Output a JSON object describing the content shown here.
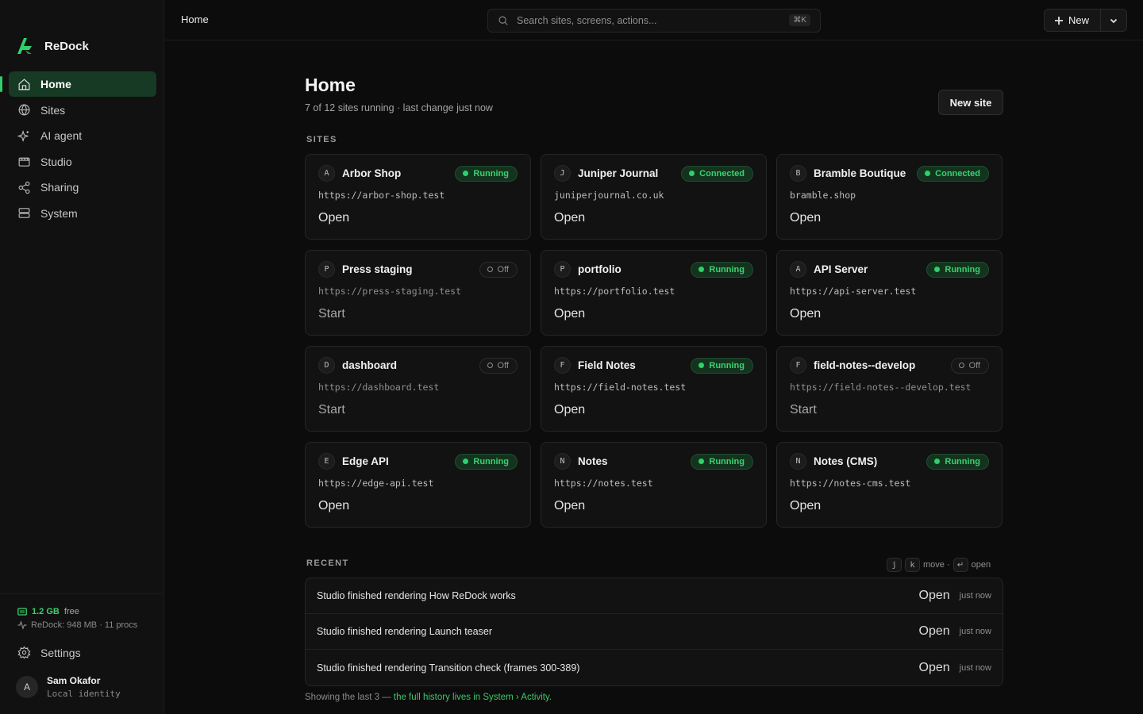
{
  "brand": {
    "name": "ReDock"
  },
  "sidebar": {
    "items": [
      {
        "label": "Home",
        "icon": "home-icon",
        "active": true
      },
      {
        "label": "Sites",
        "icon": "globe-icon"
      },
      {
        "label": "AI agent",
        "icon": "sparkles-icon"
      },
      {
        "label": "Studio",
        "icon": "film-icon"
      },
      {
        "label": "Sharing",
        "icon": "share-icon"
      },
      {
        "label": "System",
        "icon": "server-icon"
      }
    ],
    "memory": {
      "value": "1.2 GB",
      "label": "free",
      "detail": "ReDock: 948 MB · 11 procs"
    },
    "settings_label": "Settings",
    "user": {
      "initial": "A",
      "name": "Sam Okafor",
      "sub": "Local identity"
    }
  },
  "topbar": {
    "breadcrumb": "Home",
    "search_placeholder": "Search sites, screens, actions...",
    "search_shortcut": "⌘K",
    "new_label": "New"
  },
  "main": {
    "title": "Home",
    "subtitle": "7 of 12 sites running · last change just now",
    "new_site_label": "New site",
    "sites_label": "SITES",
    "sites": [
      {
        "initial": "A",
        "name": "Arbor Shop",
        "status": "Running",
        "on": true,
        "url": "https://arbor-shop.test",
        "action": "Open"
      },
      {
        "initial": "J",
        "name": "Juniper Journal",
        "status": "Connected",
        "on": true,
        "url": "juniperjournal.co.uk",
        "action": "Open"
      },
      {
        "initial": "B",
        "name": "Bramble Boutique",
        "status": "Connected",
        "on": true,
        "url": "bramble.shop",
        "action": "Open"
      },
      {
        "initial": "P",
        "name": "Press staging",
        "status": "Off",
        "on": false,
        "url": "https://press-staging.test",
        "action": "Start"
      },
      {
        "initial": "P",
        "name": "portfolio",
        "status": "Running",
        "on": true,
        "url": "https://portfolio.test",
        "action": "Open"
      },
      {
        "initial": "A",
        "name": "API Server",
        "status": "Running",
        "on": true,
        "url": "https://api-server.test",
        "action": "Open"
      },
      {
        "initial": "D",
        "name": "dashboard",
        "status": "Off",
        "on": false,
        "url": "https://dashboard.test",
        "action": "Start"
      },
      {
        "initial": "F",
        "name": "Field Notes",
        "status": "Running",
        "on": true,
        "url": "https://field-notes.test",
        "action": "Open"
      },
      {
        "initial": "F",
        "name": "field-notes--develop",
        "status": "Off",
        "on": false,
        "url": "https://field-notes--develop.test",
        "action": "Start"
      },
      {
        "initial": "E",
        "name": "Edge API",
        "status": "Running",
        "on": true,
        "url": "https://edge-api.test",
        "action": "Open"
      },
      {
        "initial": "N",
        "name": "Notes",
        "status": "Running",
        "on": true,
        "url": "https://notes.test",
        "action": "Open"
      },
      {
        "initial": "N",
        "name": "Notes (CMS)",
        "status": "Running",
        "on": true,
        "url": "https://notes-cms.test",
        "action": "Open"
      }
    ],
    "recent_label": "RECENT",
    "recent_hint": {
      "k1": "j",
      "k2": "k",
      "move": "move ·",
      "k3": "↵",
      "open": "open"
    },
    "recent": [
      {
        "text": "Studio finished rendering How ReDock works",
        "action": "Open",
        "time": "just now"
      },
      {
        "text": "Studio finished rendering Launch teaser",
        "action": "Open",
        "time": "just now"
      },
      {
        "text": "Studio finished rendering Transition check (frames 300-389)",
        "action": "Open",
        "time": "just now"
      }
    ],
    "footnote_prefix": "Showing the last 3 — ",
    "footnote_link": "the full history lives in System › Activity."
  },
  "colors": {
    "accent": "#2fd06a",
    "background": "#0c0c0c",
    "card": "#121212"
  }
}
